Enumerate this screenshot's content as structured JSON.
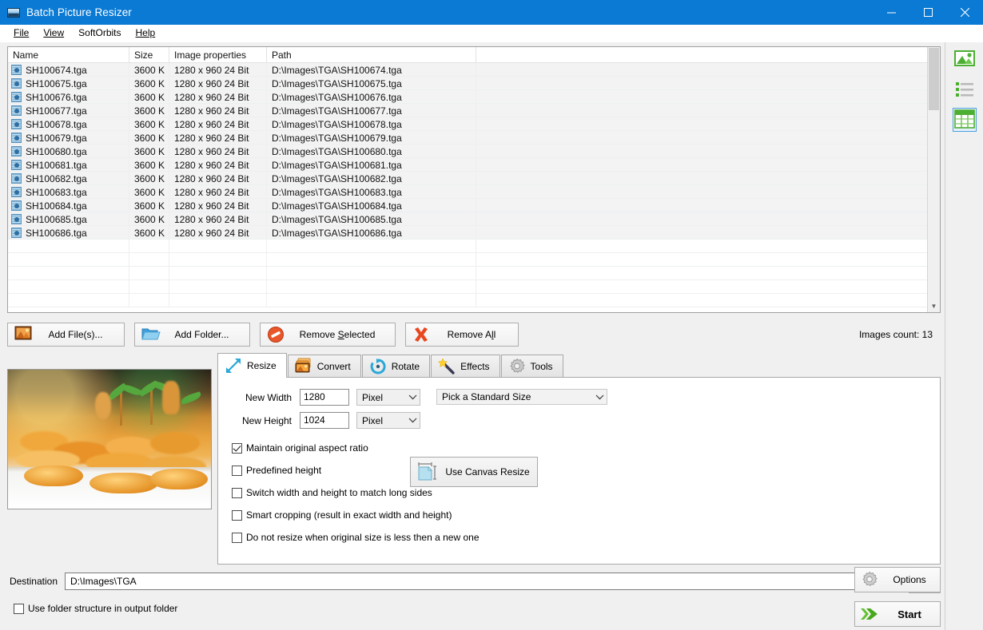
{
  "window": {
    "title": "Batch Picture Resizer",
    "app_icon": "picture-window-icon",
    "minimize": "minimize-icon",
    "maximize": "maximize-icon",
    "close": "close-icon"
  },
  "menubar": {
    "items": [
      {
        "label": "File",
        "accel": "F"
      },
      {
        "label": "View",
        "accel": "V"
      },
      {
        "label": "SoftOrbits",
        "accel": ""
      },
      {
        "label": "Help",
        "accel": "H"
      }
    ]
  },
  "file_list": {
    "columns": [
      {
        "key": "name",
        "label": "Name"
      },
      {
        "key": "size",
        "label": "Size"
      },
      {
        "key": "props",
        "label": "Image properties"
      },
      {
        "key": "path",
        "label": "Path"
      }
    ],
    "rows": [
      {
        "name": "SH100674.tga",
        "size": "3600 K",
        "props": "1280 x 960  24 Bit",
        "path": "D:\\Images\\TGA\\SH100674.tga"
      },
      {
        "name": "SH100675.tga",
        "size": "3600 K",
        "props": "1280 x 960  24 Bit",
        "path": "D:\\Images\\TGA\\SH100675.tga"
      },
      {
        "name": "SH100676.tga",
        "size": "3600 K",
        "props": "1280 x 960  24 Bit",
        "path": "D:\\Images\\TGA\\SH100676.tga"
      },
      {
        "name": "SH100677.tga",
        "size": "3600 K",
        "props": "1280 x 960  24 Bit",
        "path": "D:\\Images\\TGA\\SH100677.tga"
      },
      {
        "name": "SH100678.tga",
        "size": "3600 K",
        "props": "1280 x 960  24 Bit",
        "path": "D:\\Images\\TGA\\SH100678.tga"
      },
      {
        "name": "SH100679.tga",
        "size": "3600 K",
        "props": "1280 x 960  24 Bit",
        "path": "D:\\Images\\TGA\\SH100679.tga"
      },
      {
        "name": "SH100680.tga",
        "size": "3600 K",
        "props": "1280 x 960  24 Bit",
        "path": "D:\\Images\\TGA\\SH100680.tga"
      },
      {
        "name": "SH100681.tga",
        "size": "3600 K",
        "props": "1280 x 960  24 Bit",
        "path": "D:\\Images\\TGA\\SH100681.tga"
      },
      {
        "name": "SH100682.tga",
        "size": "3600 K",
        "props": "1280 x 960  24 Bit",
        "path": "D:\\Images\\TGA\\SH100682.tga"
      },
      {
        "name": "SH100683.tga",
        "size": "3600 K",
        "props": "1280 x 960  24 Bit",
        "path": "D:\\Images\\TGA\\SH100683.tga"
      },
      {
        "name": "SH100684.tga",
        "size": "3600 K",
        "props": "1280 x 960  24 Bit",
        "path": "D:\\Images\\TGA\\SH100684.tga"
      },
      {
        "name": "SH100685.tga",
        "size": "3600 K",
        "props": "1280 x 960  24 Bit",
        "path": "D:\\Images\\TGA\\SH100685.tga"
      },
      {
        "name": "SH100686.tga",
        "size": "3600 K",
        "props": "1280 x 960  24 Bit",
        "path": "D:\\Images\\TGA\\SH100686.tga"
      }
    ]
  },
  "actions": {
    "add_files": {
      "label": "Add File(s)...",
      "icon": "add-picture-icon"
    },
    "add_folder": {
      "label": "Add Folder...",
      "icon": "folder-icon"
    },
    "remove_selected": {
      "label": "Remove Selected",
      "icon": "no-entry-icon"
    },
    "remove_all": {
      "label": "Remove All",
      "icon": "red-cross-icon"
    },
    "images_count": "Images count: 13"
  },
  "side_rail": {
    "items": [
      {
        "name": "preview-image-view",
        "icon": "image-icon",
        "selected": false
      },
      {
        "name": "list-view",
        "icon": "list-icon",
        "selected": false
      },
      {
        "name": "grid-view",
        "icon": "grid-icon",
        "selected": true
      }
    ]
  },
  "tabs": [
    {
      "label": "Resize",
      "icon": "resize-arrows-icon",
      "active": true
    },
    {
      "label": "Convert",
      "icon": "convert-images-icon",
      "active": false
    },
    {
      "label": "Rotate",
      "icon": "rotate-icon",
      "active": false
    },
    {
      "label": "Effects",
      "icon": "magic-wand-icon",
      "active": false
    },
    {
      "label": "Tools",
      "icon": "gear-icon",
      "active": false
    }
  ],
  "resize_panel": {
    "new_width": {
      "label": "New Width",
      "value": "1280",
      "unit": "Pixel"
    },
    "new_height": {
      "label": "New Height",
      "value": "1024",
      "unit": "Pixel"
    },
    "standard_size": {
      "value": "Pick a Standard Size"
    },
    "canvas_resize": {
      "label": "Use Canvas Resize",
      "icon": "canvas-resize-icon"
    },
    "checkboxes": [
      {
        "label": "Maintain original aspect ratio",
        "checked": true
      },
      {
        "label": "Predefined height",
        "checked": false
      },
      {
        "label": "Switch width and height to match long sides",
        "checked": false
      },
      {
        "label": "Smart cropping (result in exact width and height)",
        "checked": false
      },
      {
        "label": "Do not resize when original size is less then a new one",
        "checked": false
      }
    ]
  },
  "preview": {
    "alt": "food-buffet-display-thumbnail"
  },
  "bottom": {
    "destination_label": "Destination",
    "destination_value": "D:\\Images\\TGA",
    "browse_icon": "open-folder-icon",
    "use_folder_structure": {
      "label": "Use folder structure in output folder",
      "checked": false
    },
    "options": {
      "label": "Options",
      "icon": "gear-icon"
    },
    "start": {
      "label": "Start",
      "icon": "green-arrows-icon"
    }
  },
  "colors": {
    "titlebar": "#0a7ad4",
    "accent_green": "#4caf32",
    "accent_orange": "#e8761f",
    "accent_cyan": "#2aa8d8",
    "window_bg": "#f0f0f0"
  }
}
